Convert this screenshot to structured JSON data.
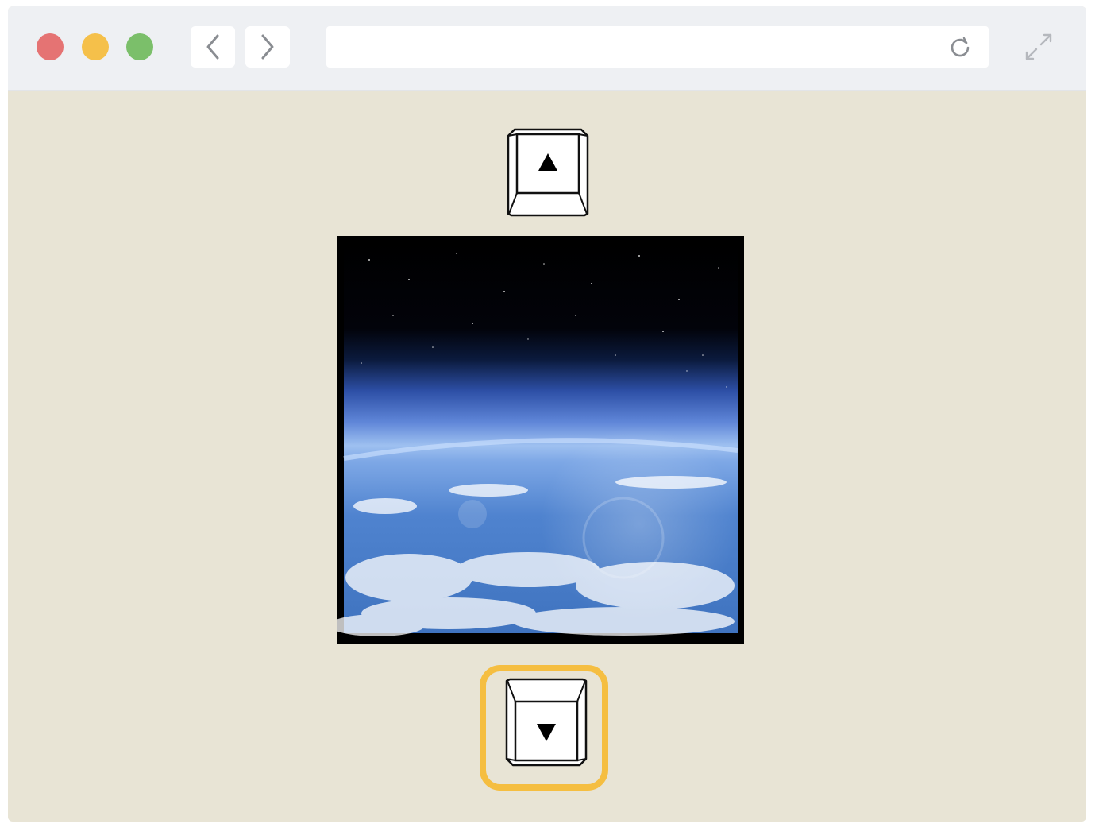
{
  "browser": {
    "url": "",
    "traffic_lights": [
      "close",
      "minimize",
      "zoom"
    ]
  },
  "controls": {
    "up_key": {
      "icon": "arrow-up-key-icon",
      "glyph": "▲"
    },
    "down_key": {
      "icon": "arrow-down-key-icon",
      "glyph": "▼",
      "highlighted": true
    }
  },
  "image": {
    "subject": "earth-from-space-photo"
  },
  "colors": {
    "page_background": "#e8e4d5",
    "highlight": "#f5be41",
    "toolbar": "#eef0f3"
  }
}
